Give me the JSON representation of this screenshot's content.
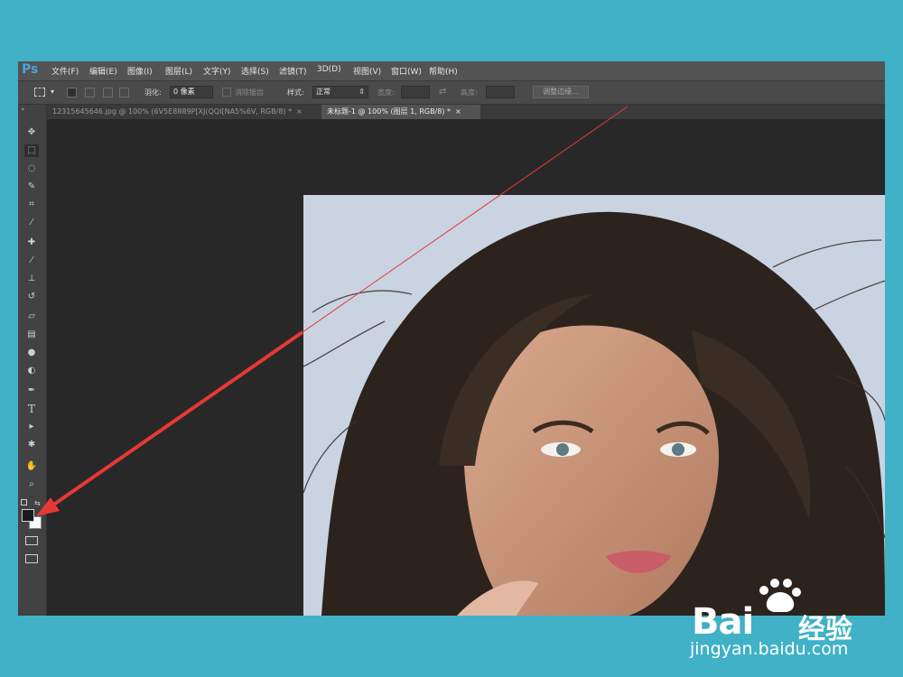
{
  "app": {
    "logo": "Ps"
  },
  "menu": [
    "文件(F)",
    "编辑(E)",
    "图像(I)",
    "图层(L)",
    "文字(Y)",
    "选择(S)",
    "滤镜(T)",
    "3D(D)",
    "视图(V)",
    "窗口(W)",
    "帮助(H)"
  ],
  "options": {
    "feather_label": "羽化:",
    "feather_value": "0 像素",
    "antialias_label": "消除锯齿",
    "style_label": "样式:",
    "style_value": "正常",
    "width_label": "宽度:",
    "height_label": "高度:",
    "refine_edge": "调整边缘..."
  },
  "tabs": [
    {
      "title": "12315645646.jpg @ 100% (6V5E8889P[XJ(QQI[NA5%6V, RGB/8) *",
      "close": "×",
      "active": false
    },
    {
      "title": "未标题-1 @ 100% (图层 1, RGB/8) *",
      "close": "×",
      "active": true
    }
  ],
  "tools": [
    "move-tool",
    "marquee-tool",
    "lasso-tool",
    "quick-select-tool",
    "crop-tool",
    "eyedropper-tool",
    "healing-brush-tool",
    "brush-tool",
    "clone-stamp-tool",
    "history-brush-tool",
    "eraser-tool",
    "gradient-tool",
    "blur-tool",
    "dodge-tool",
    "pen-tool",
    "type-tool",
    "path-select-tool",
    "shape-tool",
    "hand-tool",
    "zoom-tool"
  ],
  "tool_glyphs": {
    "type-tool": "T"
  },
  "colors": {
    "foreground": "#1a1a1a",
    "background": "#ffffff",
    "annotation_arrow": "#e53935",
    "page_bg": "#40b1c7"
  },
  "watermark": {
    "brand": "Bai",
    "brand_suffix": "经验",
    "url": "jingyan.baidu.com"
  }
}
